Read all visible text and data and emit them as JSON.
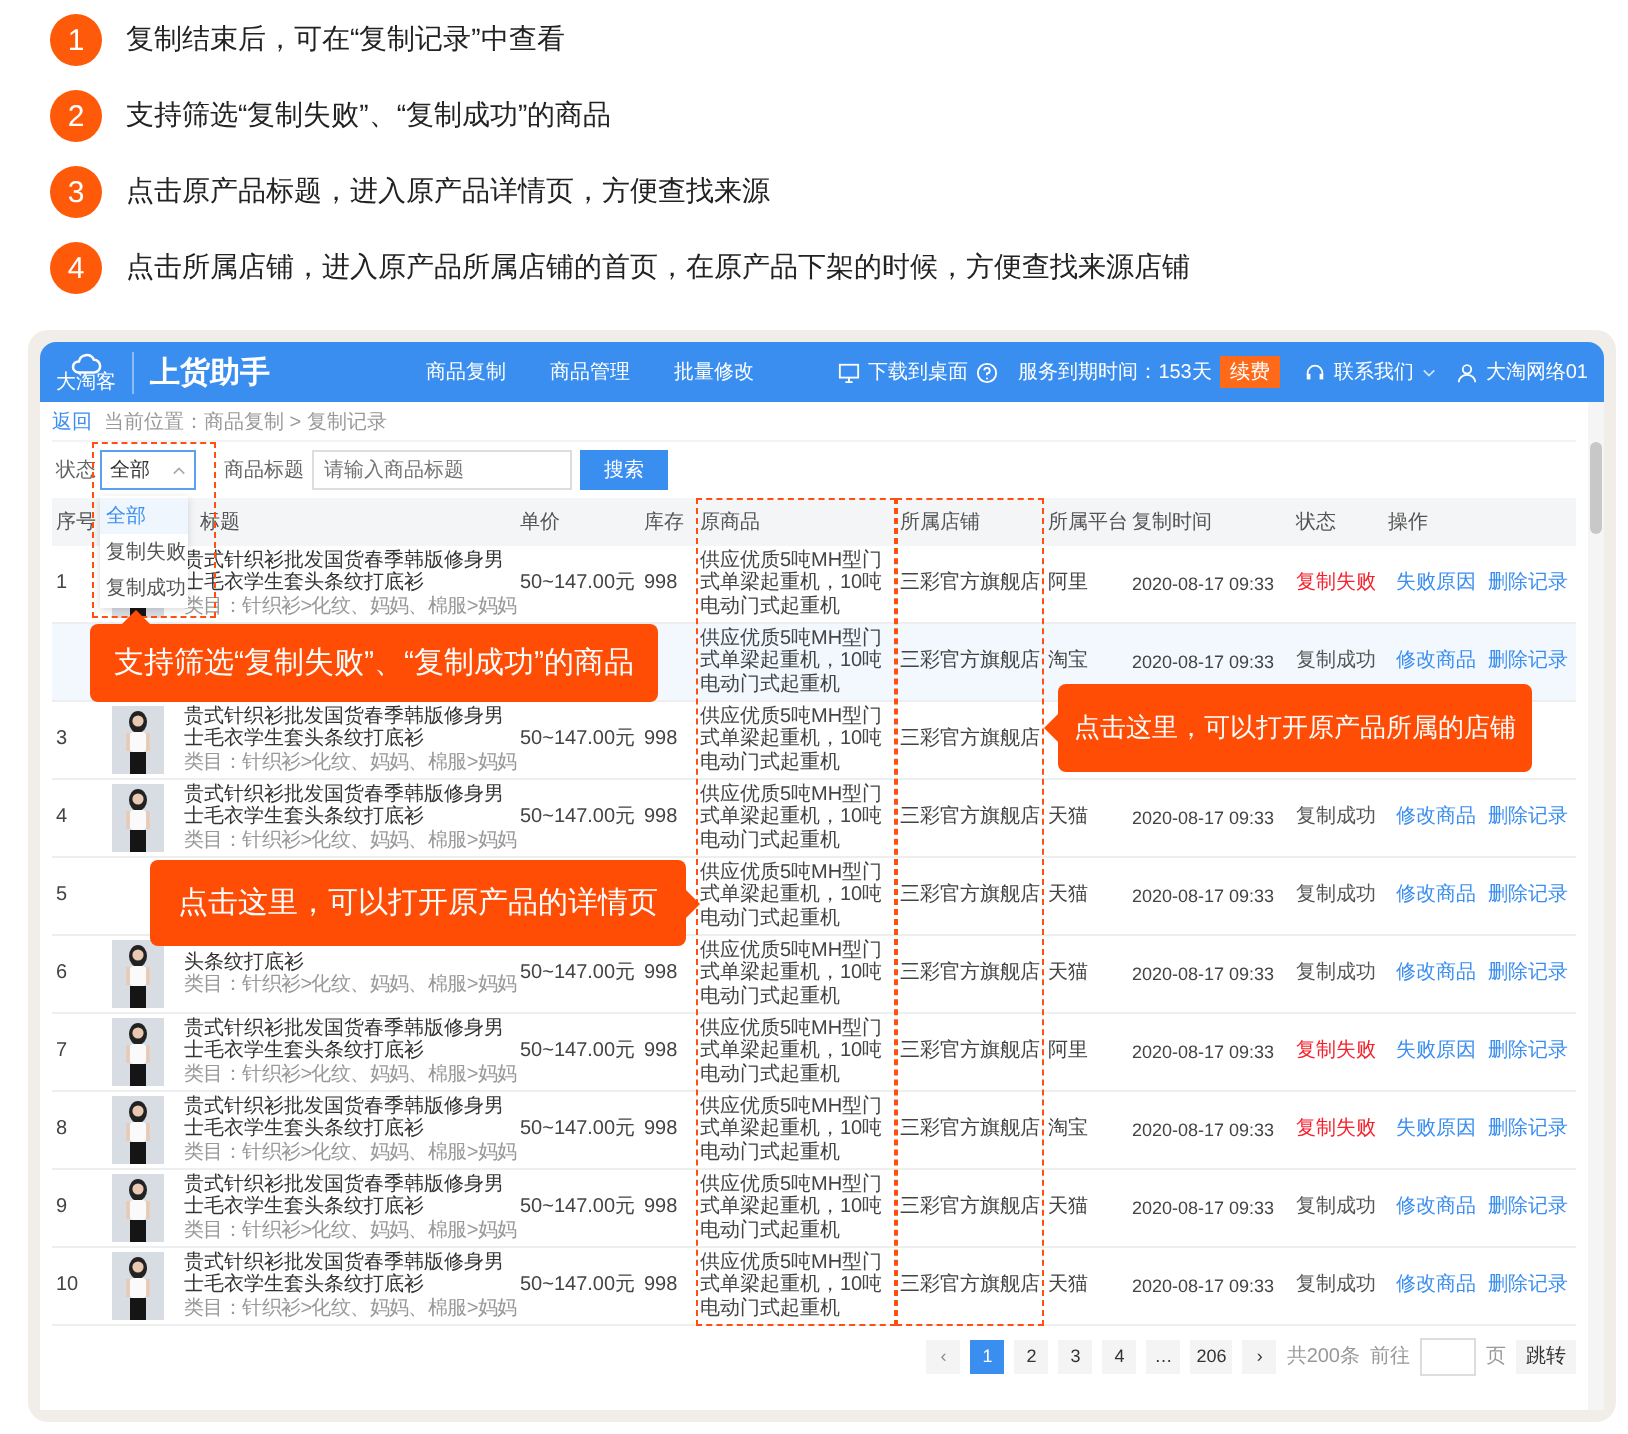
{
  "steps": [
    {
      "number": "1",
      "text": "复制结束后，可在“复制记录”中查看"
    },
    {
      "number": "2",
      "text": "支持筛选“复制失败”、“复制成功”的商品"
    },
    {
      "number": "3",
      "text": "点击原产品标题，进入原产品详情页，方便查找来源"
    },
    {
      "number": "4",
      "text": "点击所属店铺，进入原产品所属店铺的首页，在原产品下架的时候，方便查找来源店铺"
    }
  ],
  "app": {
    "logo_caption": "大淘客",
    "title": "上货助手",
    "nav": [
      "商品复制",
      "商品管理",
      "批量修改"
    ],
    "download": "下载到桌面",
    "expiry": "服务到期时间：153天",
    "renew": "续费",
    "contact": "联系我们",
    "user": "大淘网络01"
  },
  "breadcrumb": {
    "back": "返回",
    "path": "当前位置：商品复制 > 复制记录"
  },
  "filter": {
    "status_label": "状态",
    "status_value": "全部",
    "options": [
      {
        "label": "全部",
        "selected": true
      },
      {
        "label": "复制失败",
        "selected": false
      },
      {
        "label": "复制成功",
        "selected": false
      }
    ],
    "title_label": "商品标题",
    "title_placeholder": "请输入商品标题",
    "search": "搜索"
  },
  "table": {
    "columns": [
      "序号",
      "标题",
      "单价",
      "库存",
      "原商品",
      "所属店铺",
      "所属平台",
      "复制时间",
      "状态",
      "操作"
    ],
    "rows": [
      {
        "seq": "1",
        "image": {
          "kind": "picture"
        },
        "title": "贵式针织衫批发国货春季韩版修身男士毛衣学生套头条纹打底衫",
        "category": "类目：针织衫>化纹、妈妈、棉服>妈妈",
        "price": "50~147.00元",
        "stock": "998",
        "source": "供应优质5吨MH型门式单梁起重机，10吨电动门式起重机",
        "shop": "三彩官方旗舰店",
        "platform": "阿里",
        "time": "2020-08-17 09:33",
        "status": "复制失败",
        "failed": true,
        "highlight": false,
        "actions": [
          "失败原因",
          "删除记录"
        ]
      },
      {
        "highlight": true,
        "source": "供应优质5吨MH型门式单梁起重机，10吨电动门式起重机",
        "shop": "三彩官方旗舰店",
        "platform": "淘宝",
        "time": "2020-08-17 09:33",
        "status": "复制成功",
        "failed": false,
        "actions": [
          "修改商品",
          "删除记录"
        ]
      },
      {
        "seq": "3",
        "image": {
          "kind": "picture"
        },
        "title": "贵式针织衫批发国货春季韩版修身男士毛衣学生套头条纹打底衫",
        "category": "类目：针织衫>化纹、妈妈、棉服>妈妈",
        "price": "50~147.00元",
        "stock": "998",
        "source": "供应优质5吨MH型门式单梁起重机，10吨电动门式起重机",
        "shop": "三彩官方旗舰店",
        "highlight": false
      },
      {
        "seq": "4",
        "image": {
          "kind": "picture"
        },
        "title": "贵式针织衫批发国货春季韩版修身男士毛衣学生套头条纹打底衫",
        "category": "类目：针织衫>化纹、妈妈、棉服>妈妈",
        "price": "50~147.00元",
        "stock": "998",
        "source": "供应优质5吨MH型门式单梁起重机，10吨电动门式起重机",
        "shop": "三彩官方旗舰店",
        "platform": "天猫",
        "time": "2020-08-17 09:33",
        "status": "复制成功",
        "failed": false,
        "highlight": false,
        "actions": [
          "修改商品",
          "删除记录"
        ]
      },
      {
        "seq": "5",
        "source": "供应优质5吨MH型门式单梁起重机，10吨电动门式起重机",
        "shop": "三彩官方旗舰店",
        "platform": "天猫",
        "time": "2020-08-17 09:33",
        "status": "复制成功",
        "failed": false,
        "highlight": false,
        "actions": [
          "修改商品",
          "删除记录"
        ]
      },
      {
        "seq": "6",
        "image": {
          "kind": "picture"
        },
        "title": "头条纹打底衫",
        "category": "类目：针织衫>化纹、妈妈、棉服>妈妈",
        "price": "50~147.00元",
        "stock": "998",
        "source": "供应优质5吨MH型门式单梁起重机，10吨电动门式起重机",
        "shop": "三彩官方旗舰店",
        "platform": "天猫",
        "time": "2020-08-17 09:33",
        "status": "复制成功",
        "failed": false,
        "highlight": false,
        "actions": [
          "修改商品",
          "删除记录"
        ]
      },
      {
        "seq": "7",
        "image": {
          "kind": "picture"
        },
        "title": "贵式针织衫批发国货春季韩版修身男士毛衣学生套头条纹打底衫",
        "category": "类目：针织衫>化纹、妈妈、棉服>妈妈",
        "price": "50~147.00元",
        "stock": "998",
        "source": "供应优质5吨MH型门式单梁起重机，10吨电动门式起重机",
        "shop": "三彩官方旗舰店",
        "platform": "阿里",
        "time": "2020-08-17 09:33",
        "status": "复制失败",
        "failed": true,
        "highlight": false,
        "actions": [
          "失败原因",
          "删除记录"
        ]
      },
      {
        "seq": "8",
        "image": {
          "kind": "picture"
        },
        "title": "贵式针织衫批发国货春季韩版修身男士毛衣学生套头条纹打底衫",
        "category": "类目：针织衫>化纹、妈妈、棉服>妈妈",
        "price": "50~147.00元",
        "stock": "998",
        "source": "供应优质5吨MH型门式单梁起重机，10吨电动门式起重机",
        "shop": "三彩官方旗舰店",
        "platform": "淘宝",
        "time": "2020-08-17 09:33",
        "status": "复制失败",
        "failed": true,
        "highlight": false,
        "actions": [
          "失败原因",
          "删除记录"
        ]
      },
      {
        "seq": "9",
        "image": {
          "kind": "picture"
        },
        "title": "贵式针织衫批发国货春季韩版修身男士毛衣学生套头条纹打底衫",
        "category": "类目：针织衫>化纹、妈妈、棉服>妈妈",
        "price": "50~147.00元",
        "stock": "998",
        "source": "供应优质5吨MH型门式单梁起重机，10吨电动门式起重机",
        "shop": "三彩官方旗舰店",
        "platform": "天猫",
        "time": "2020-08-17 09:33",
        "status": "复制成功",
        "failed": false,
        "highlight": false,
        "actions": [
          "修改商品",
          "删除记录"
        ]
      },
      {
        "seq": "10",
        "image": {
          "kind": "picture"
        },
        "title": "贵式针织衫批发国货春季韩版修身男士毛衣学生套头条纹打底衫",
        "category": "类目：针织衫>化纹、妈妈、棉服>妈妈",
        "price": "50~147.00元",
        "stock": "998",
        "source": "供应优质5吨MH型门式单梁起重机，10吨电动门式起重机",
        "shop": "三彩官方旗舰店",
        "platform": "天猫",
        "time": "2020-08-17 09:33",
        "status": "复制成功",
        "failed": false,
        "highlight": false,
        "actions": [
          "修改商品",
          "删除记录"
        ]
      }
    ]
  },
  "pagination": {
    "prev": "‹",
    "pages": [
      {
        "label": "1",
        "selected": true
      },
      {
        "label": "2",
        "selected": false
      },
      {
        "label": "3",
        "selected": false
      },
      {
        "label": "4",
        "selected": false
      },
      {
        "label": "…",
        "selected": false
      },
      {
        "label": "206",
        "selected": false
      }
    ],
    "next": "›",
    "total": "共200条",
    "goto": "前往",
    "page_unit": "页",
    "jump": "跳转"
  },
  "callouts": [
    {
      "kind": "up",
      "text": "支持筛选“复制失败”、“复制成功”的商品"
    },
    {
      "kind": "left",
      "text": "点击这里，可以打开原产品所属的店铺"
    },
    {
      "kind": "right",
      "text": "点击这里，可以打开原产品的详情页"
    }
  ]
}
